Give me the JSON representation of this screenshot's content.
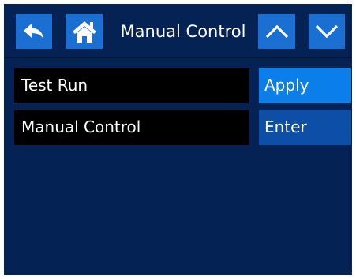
{
  "header": {
    "title": "Manual Control",
    "back_icon": "back-arrow-icon",
    "home_icon": "home-icon",
    "up_icon": "chevron-up-icon",
    "down_icon": "chevron-down-icon"
  },
  "rows": [
    {
      "label": "Test Run",
      "button": "Apply"
    },
    {
      "label": "Manual Control",
      "button": "Enter"
    }
  ],
  "colors": {
    "background": "#042253",
    "header_button": "#1a6fd2",
    "apply_button": "#0b7fe9",
    "enter_button": "#0d4ea7",
    "row_label_bg": "#000000",
    "text": "#ffffff"
  }
}
